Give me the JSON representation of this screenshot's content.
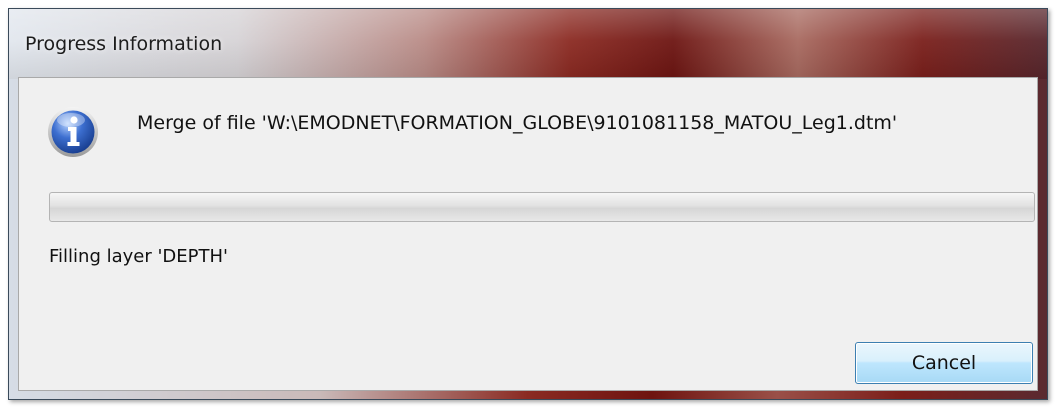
{
  "window": {
    "title": "Progress Information"
  },
  "dialog": {
    "icon": "info-icon",
    "message": "Merge of file 'W:\\EMODNET\\FORMATION_GLOBE\\9101081158_MATOU_Leg1.dtm'",
    "progress": 0,
    "status": "Filling layer 'DEPTH'",
    "cancel_label": "Cancel"
  },
  "colors": {
    "client_bg": "#f0f0f0",
    "button_border": "#3c7fb1",
    "icon_blue": "#2a5db0"
  }
}
